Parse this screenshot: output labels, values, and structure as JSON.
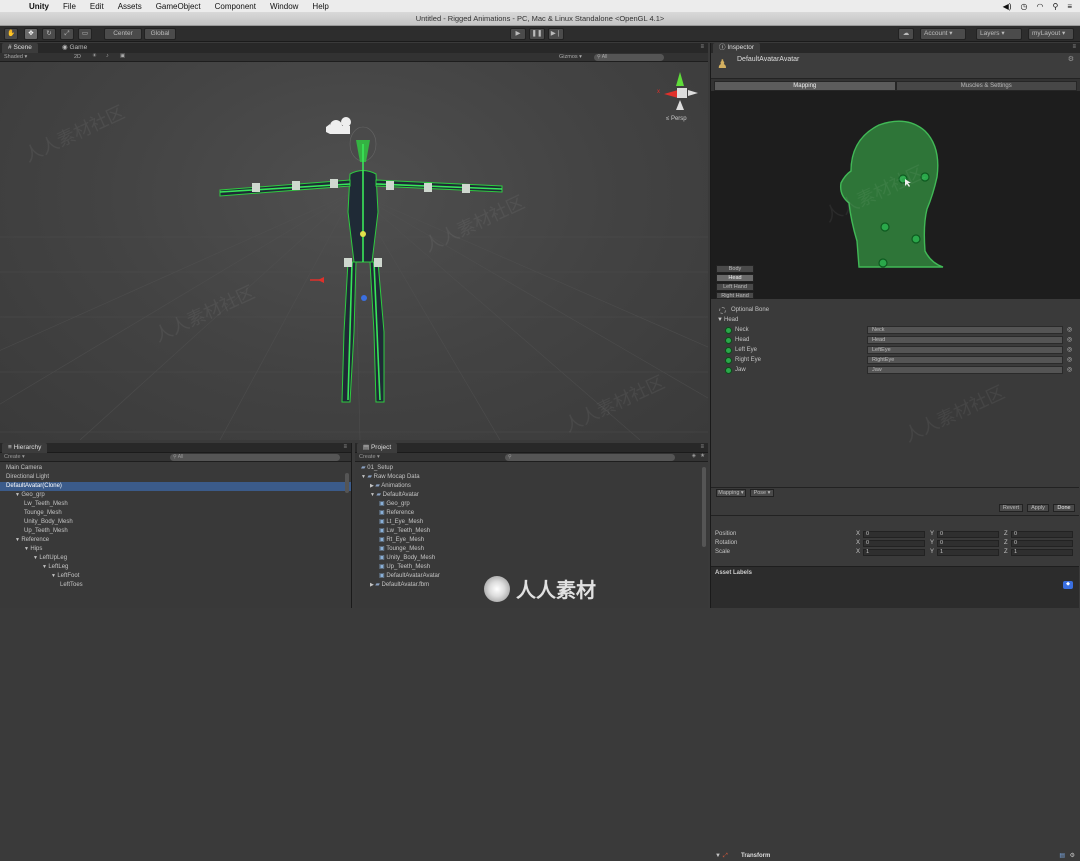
{
  "menubar": {
    "app": "Unity",
    "items": [
      "File",
      "Edit",
      "Assets",
      "GameObject",
      "Component",
      "Window",
      "Help"
    ]
  },
  "window_title": "Untitled - Rigged Animations - PC, Mac & Linux Standalone <OpenGL 4.1>",
  "toolbar": {
    "pivot": "Center",
    "space": "Global",
    "account": "Account",
    "layers": "Layers",
    "layout": "myLayout"
  },
  "scene": {
    "tabs": [
      "Scene",
      "Game"
    ],
    "shading": "Shaded",
    "mode_2d": "2D",
    "gizmos": "Gizmos",
    "search_all": "All",
    "persp": "Persp",
    "gizmo_x": "x"
  },
  "hierarchy": {
    "tab": "Hierarchy",
    "create": "Create",
    "search": "All",
    "rows": [
      {
        "label": "Main Camera",
        "indent": 0
      },
      {
        "label": "Directional Light",
        "indent": 0
      },
      {
        "label": "DefaultAvatar(Clone)",
        "indent": 0,
        "selected": true
      },
      {
        "label": "Geo_grp",
        "indent": 1,
        "arrow": "▼"
      },
      {
        "label": "Lw_Teeth_Mesh",
        "indent": 2
      },
      {
        "label": "Tounge_Mesh",
        "indent": 2
      },
      {
        "label": "Unity_Body_Mesh",
        "indent": 2
      },
      {
        "label": "Up_Teeth_Mesh",
        "indent": 2
      },
      {
        "label": "Reference",
        "indent": 1,
        "arrow": "▼"
      },
      {
        "label": "Hips",
        "indent": 2,
        "arrow": "▼"
      },
      {
        "label": "LeftUpLeg",
        "indent": 3,
        "arrow": "▼"
      },
      {
        "label": "LeftLeg",
        "indent": 4,
        "arrow": "▼"
      },
      {
        "label": "LeftFoot",
        "indent": 5,
        "arrow": "▼"
      },
      {
        "label": "LeftToes",
        "indent": 6
      }
    ]
  },
  "project": {
    "tab": "Project",
    "create": "Create",
    "rows": [
      {
        "label": "01_Setup",
        "indent": 0
      },
      {
        "label": "Raw Mocap Data",
        "indent": 0,
        "arrow": "▼"
      },
      {
        "label": "Animations",
        "indent": 1,
        "arrow": "▶"
      },
      {
        "label": "DefaultAvatar",
        "indent": 1,
        "arrow": "▼"
      },
      {
        "label": "Geo_grp",
        "indent": 2
      },
      {
        "label": "Reference",
        "indent": 2
      },
      {
        "label": "Lt_Eye_Mesh",
        "indent": 2
      },
      {
        "label": "Lw_Teeth_Mesh",
        "indent": 2
      },
      {
        "label": "Rt_Eye_Mesh",
        "indent": 2
      },
      {
        "label": "Tounge_Mesh",
        "indent": 2
      },
      {
        "label": "Unity_Body_Mesh",
        "indent": 2
      },
      {
        "label": "Up_Teeth_Mesh",
        "indent": 2
      },
      {
        "label": "DefaultAvatarAvatar",
        "indent": 2
      },
      {
        "label": "DefaultAvatar.fbm",
        "indent": 1,
        "arrow": "▶"
      }
    ]
  },
  "inspector": {
    "tab": "Inspector",
    "object_name": "DefaultAvatarAvatar",
    "tabs": [
      "Mapping",
      "Muscles & Settings"
    ],
    "body_parts": [
      "Body",
      "Head",
      "Left Hand",
      "Right Hand"
    ],
    "optional_bone": "Optional Bone",
    "head_section": "Head",
    "bones": [
      {
        "name": "Neck",
        "value": "Neck"
      },
      {
        "name": "Head",
        "value": "Head"
      },
      {
        "name": "Left Eye",
        "value": "LeftEye"
      },
      {
        "name": "Right Eye",
        "value": "RightEye"
      },
      {
        "name": "Jaw",
        "value": "Jaw"
      }
    ],
    "mapping_btn": "Mapping",
    "pose_btn": "Pose",
    "revert": "Revert",
    "apply": "Apply",
    "done": "Done",
    "transform": {
      "title": "Transform",
      "rows": [
        {
          "label": "Position",
          "x": "0",
          "y": "0",
          "z": "0"
        },
        {
          "label": "Rotation",
          "x": "0",
          "y": "0",
          "z": "0"
        },
        {
          "label": "Scale",
          "x": "1",
          "y": "1",
          "z": "1"
        }
      ]
    },
    "asset_labels": "Asset Labels"
  },
  "watermark": {
    "logo_text": "人人素材",
    "center": "人人素材",
    "repeated": "人人素材社区"
  },
  "colors": {
    "bone_green": "#2ecc40",
    "selection_blue": "#3b5b8a",
    "dark_panel": "#1d1d1d"
  }
}
